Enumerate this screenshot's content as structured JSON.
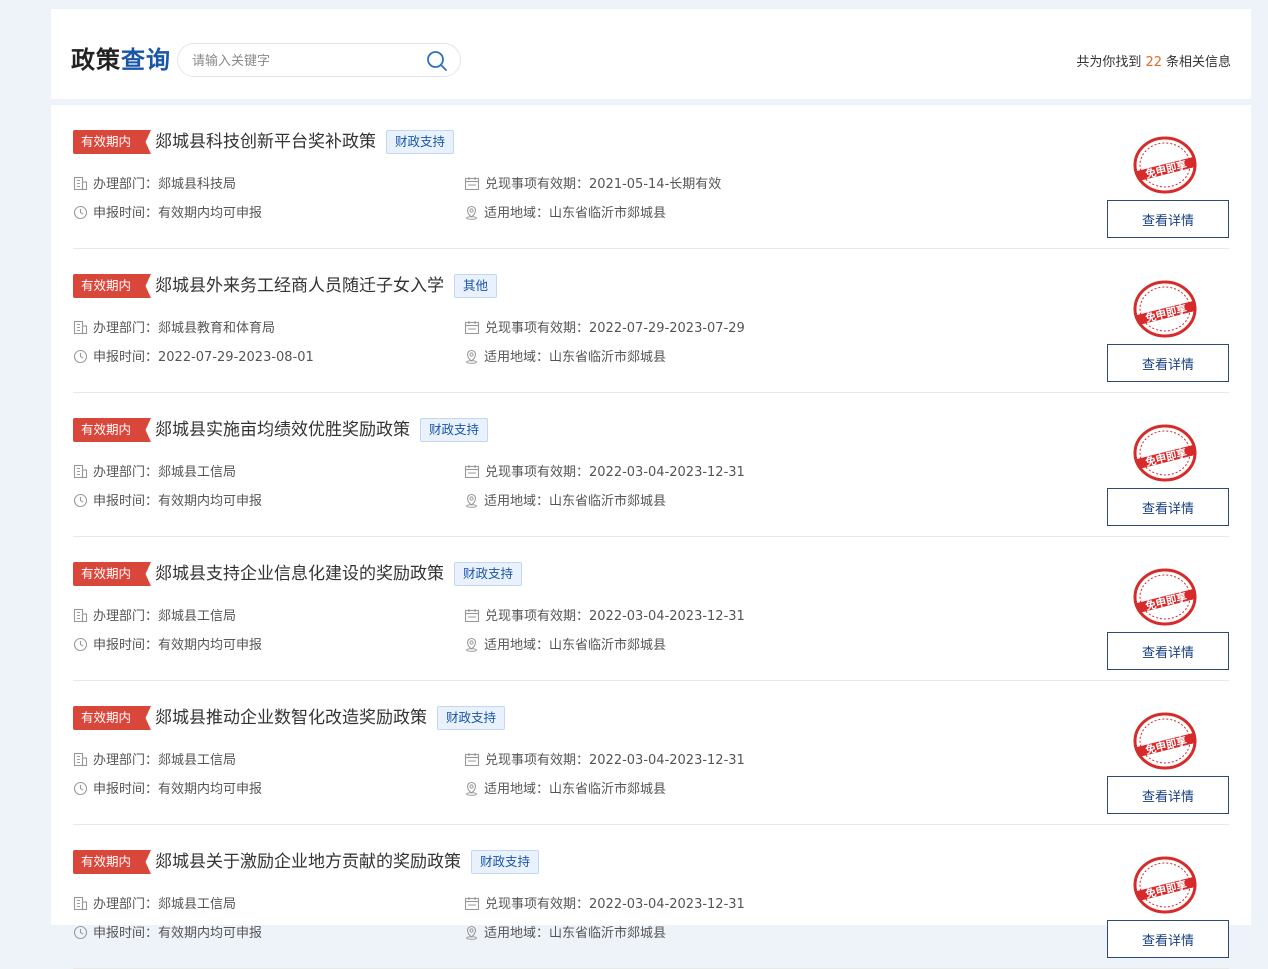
{
  "header": {
    "title_part1": "政策",
    "title_part2": "查询",
    "search_placeholder": "请输入关键字",
    "count_prefix": "共为你找到",
    "count": "22",
    "count_suffix": "条相关信息"
  },
  "labels": {
    "dept": "办理部门：",
    "valid_period": "兑现事项有效期：",
    "apply_time": "申报时间：",
    "region": "适用地域：",
    "detail_button": "查看详情",
    "stamp_text": "免申即享"
  },
  "colors": {
    "accent_red": "#d9463a",
    "brand_blue": "#1a56a8",
    "count_orange": "#e06c2c"
  },
  "items": [
    {
      "status": "有效期内",
      "title": "郯城县科技创新平台奖补政策",
      "tag": "财政支持",
      "dept": "郯城县科技局",
      "valid_period": "2021-05-14-长期有效",
      "apply_time": "有效期内均可申报",
      "region": "山东省临沂市郯城县"
    },
    {
      "status": "有效期内",
      "title": "郯城县外来务工经商人员随迁子女入学",
      "tag": "其他",
      "dept": "郯城县教育和体育局",
      "valid_period": "2022-07-29-2023-07-29",
      "apply_time": "2022-07-29-2023-08-01",
      "region": "山东省临沂市郯城县"
    },
    {
      "status": "有效期内",
      "title": "郯城县实施亩均绩效优胜奖励政策",
      "tag": "财政支持",
      "dept": "郯城县工信局",
      "valid_period": "2022-03-04-2023-12-31",
      "apply_time": "有效期内均可申报",
      "region": "山东省临沂市郯城县"
    },
    {
      "status": "有效期内",
      "title": "郯城县支持企业信息化建设的奖励政策",
      "tag": "财政支持",
      "dept": "郯城县工信局",
      "valid_period": "2022-03-04-2023-12-31",
      "apply_time": "有效期内均可申报",
      "region": "山东省临沂市郯城县"
    },
    {
      "status": "有效期内",
      "title": "郯城县推动企业数智化改造奖励政策",
      "tag": "财政支持",
      "dept": "郯城县工信局",
      "valid_period": "2022-03-04-2023-12-31",
      "apply_time": "有效期内均可申报",
      "region": "山东省临沂市郯城县"
    },
    {
      "status": "有效期内",
      "title": "郯城县关于激励企业地方贡献的奖励政策",
      "tag": "财政支持",
      "dept": "郯城县工信局",
      "valid_period": "2022-03-04-2023-12-31",
      "apply_time": "有效期内均可申报",
      "region": "山东省临沂市郯城县"
    }
  ]
}
